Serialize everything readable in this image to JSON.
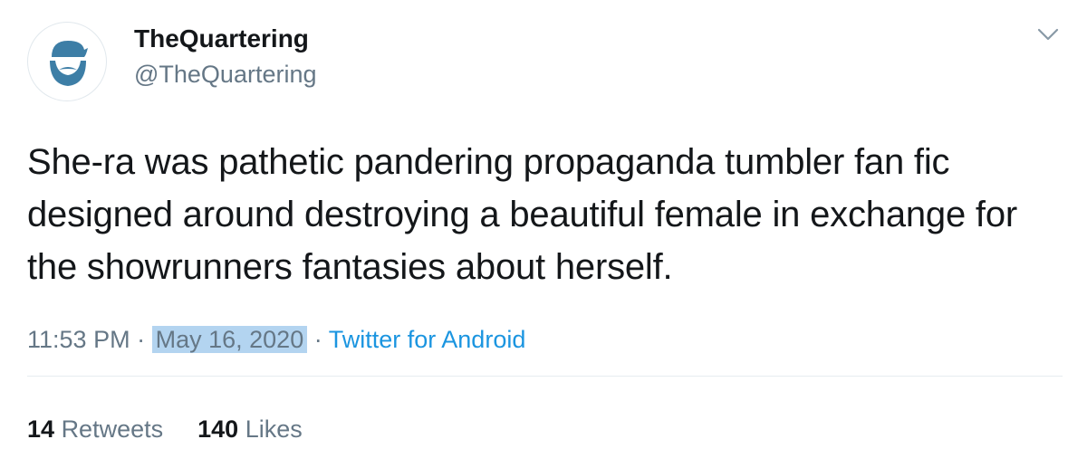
{
  "tweet": {
    "author_name": "TheQuartering",
    "author_handle": "@TheQuartering",
    "text": "She-ra was pathetic pandering propaganda tumbler fan fic designed around destroying a beautiful female in exchange for the showrunners fantasies about herself.",
    "time": "11:53 PM",
    "separator": "·",
    "date": "May 16, 2020",
    "source": "Twitter for Android",
    "retweets_count": "14",
    "retweets_label": "Retweets",
    "likes_count": "140",
    "likes_label": "Likes"
  },
  "icons": {
    "avatar": "bearded-man-avatar-icon",
    "menu": "chevron-down-icon"
  },
  "colors": {
    "text_primary": "#14171a",
    "text_secondary": "#657786",
    "link": "#1b95e0",
    "selection_highlight": "#b3d4f0",
    "avatar_brand": "#3d7ea6"
  }
}
